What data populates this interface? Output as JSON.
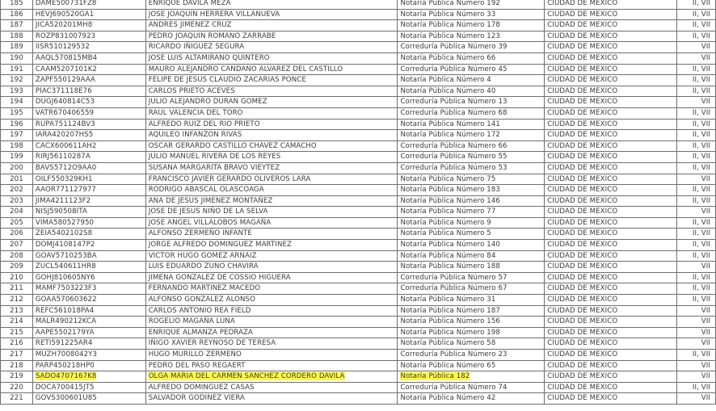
{
  "rows": [
    {
      "n": "185",
      "rfc": "DAME500731FZ8",
      "name": "ENRIQUE DAVILA MEZA",
      "office": "Notaría Pública Número 192",
      "city": "CIUDAD DE MEXICO",
      "grp": "II, VII",
      "hl": false
    },
    {
      "n": "186",
      "rfc": "HEVJ690520GA1",
      "name": "JOSE JOAQUIN HERRERA VILLANUEVA",
      "office": "Notaría Pública Número 33",
      "city": "CIUDAD DE MEXICO",
      "grp": "II, VII",
      "hl": false
    },
    {
      "n": "187",
      "rfc": "JICA520201MH8",
      "name": "ANDRES JIMENEZ CRUZ",
      "office": "Notaría Pública Número 178",
      "city": "CIUDAD DE MEXICO",
      "grp": "II, VII",
      "hl": false
    },
    {
      "n": "188",
      "rfc": "ROZP831007923",
      "name": "PEDRO JOAQUIN ROMANO ZARRABE",
      "office": "Notaría Pública Número 123",
      "city": "CIUDAD DE MEXICO",
      "grp": "II, VII",
      "hl": false
    },
    {
      "n": "189",
      "rfc": "IISR510129532",
      "name": "RICARDO IÑIGUEZ SEGURA",
      "office": "Correduría Pública Número 39",
      "city": "CIUDAD DE MEXICO",
      "grp": "VII",
      "hl": false
    },
    {
      "n": "190",
      "rfc": "AAQL570815MB4",
      "name": "JOSE LUIS ALTAMIRANO QUINTERO",
      "office": "Notaría Pública Número 66",
      "city": "CIUDAD DE MEXICO",
      "grp": "VII",
      "hl": false
    },
    {
      "n": "191",
      "rfc": "CAAM5207101K2",
      "name": "MAURO ALEJANDRO CANDANO ALVAREZ DEL CASTILLO",
      "office": "Correduría Pública Número 45",
      "city": "CIUDAD DE MEXICO",
      "grp": "II, VII",
      "hl": false
    },
    {
      "n": "192",
      "rfc": "ZAPF550129AAA",
      "name": "FELIPE DE JESUS CLAUDIO ZACARIAS PONCE",
      "office": "Notaría Pública Número 4",
      "city": "CIUDAD DE MEXICO",
      "grp": "II, VII",
      "hl": false
    },
    {
      "n": "193",
      "rfc": "PIAC371118E76",
      "name": "CARLOS PRIETO ACEVES",
      "office": "Notaría Pública Número 40",
      "city": "CIUDAD DE MEXICO",
      "grp": "II, VII",
      "hl": false
    },
    {
      "n": "194",
      "rfc": "DUGJ640814C53",
      "name": "JULIO ALEJANDRO DURAN GOMEZ",
      "office": "Correduría Pública Número 13",
      "city": "CIUDAD DE MEXICO",
      "grp": "VII",
      "hl": false
    },
    {
      "n": "195",
      "rfc": "VATR670406559",
      "name": "RAUL VALENCIA DEL TORO",
      "office": "Correduría Pública Número 68",
      "city": "CIUDAD DE MEXICO",
      "grp": "II, VII",
      "hl": false
    },
    {
      "n": "196",
      "rfc": "RUPA751124BV3",
      "name": "ALFREDO RUIZ DEL RIO PRIETO",
      "office": "Notaría Pública Número 141",
      "city": "CIUDAD DE MEXICO",
      "grp": "II, VII",
      "hl": false
    },
    {
      "n": "197",
      "rfc": "IARA420207HS5",
      "name": "AQUILEO INFANZON RIVAS",
      "office": "Notaría Pública Número 172",
      "city": "CIUDAD DE MEXICO",
      "grp": "II, VII",
      "hl": false
    },
    {
      "n": "198",
      "rfc": "CACX600611AH2",
      "name": "OSCAR GERARDO CASTILLO CHAVEZ CAMACHO",
      "office": "Correduría Pública Número 66",
      "city": "CIUDAD DE MEXICO",
      "grp": "II, VII",
      "hl": false
    },
    {
      "n": "199",
      "rfc": "RIRJ56110287A",
      "name": "JULIO MANUEL RIVERA DE LOS REYES",
      "office": "Correduría Pública Número 55",
      "city": "CIUDAD DE MEXICO",
      "grp": "II, VII",
      "hl": false
    },
    {
      "n": "200",
      "rfc": "BAVS5712O9AA0",
      "name": "SUSANA MARGARITA BRAVO VIEYTEZ",
      "office": "Correduría Pública Número 53",
      "city": "CIUDAD DE MEXICO",
      "grp": "II, VII",
      "hl": false
    },
    {
      "n": "201",
      "rfc": "OILF550329KH1",
      "name": "FRANCISCO JAVIER GERARDO OLIVEROS LARA",
      "office": "Notaría Pública Número 75",
      "city": "CIUDAD DE MEXICO",
      "grp": "VII",
      "hl": false
    },
    {
      "n": "202",
      "rfc": "AAOR771127977",
      "name": "RODRIGO ABASCAL OLASCOAGA",
      "office": "Notaría Pública Número 183",
      "city": "CIUDAD DE MEXICO",
      "grp": "II, VII",
      "hl": false
    },
    {
      "n": "203",
      "rfc": "JIMA4211123F2",
      "name": "ANA DE JESUS JIMENEZ MONTAÑEZ",
      "office": "Notaría Pública Número 146",
      "city": "CIUDAD DE MEXICO",
      "grp": "II, VII",
      "hl": false
    },
    {
      "n": "204",
      "rfc": "NISJ590508ITA",
      "name": "JOSE DE JESUS NIÑO DE LA SELVA",
      "office": "Notaría Pública Número 77",
      "city": "CIUDAD DE MEXICO",
      "grp": "VII",
      "hl": false
    },
    {
      "n": "205",
      "rfc": "VIMA580527950",
      "name": "JOSE ANGEL VILLALOBOS MAGAÑA",
      "office": "Notaría Pública Número 9",
      "city": "CIUDAD DE MEXICO",
      "grp": "II, VII",
      "hl": false
    },
    {
      "n": "206",
      "rfc": "ZEIA5402102S8",
      "name": "ALFONSO ZERMEÑO INFANTE",
      "office": "Notaría Pública Número 5",
      "city": "CIUDAD DE MEXICO",
      "grp": "II, VII",
      "hl": false
    },
    {
      "n": "207",
      "rfc": "DOMJ4108147P2",
      "name": "JORGE ALFREDO DOMINGUEZ MARTINEZ",
      "office": "Notaría Pública Número 140",
      "city": "CIUDAD DE MEXICO",
      "grp": "II, VII",
      "hl": false
    },
    {
      "n": "208",
      "rfc": "GOAV5710253BA",
      "name": "VICTOR HUGO GOMEZ ARNAIZ",
      "office": "Notaría Pública Número 84",
      "city": "CIUDAD DE MEXICO",
      "grp": "II, VII",
      "hl": false
    },
    {
      "n": "209",
      "rfc": "ZUCL540611HR8",
      "name": "LUIS EDUARDO ZUNO CHAVIRA",
      "office": "Notaría Pública Número 188",
      "city": "CIUDAD DE MEXICO",
      "grp": "VII",
      "hl": false
    },
    {
      "n": "210",
      "rfc": "GOHJ810605NY6",
      "name": "JIMENA GONZALEZ DE COSSIO HIGUERA",
      "office": "Correduría Pública Número 57",
      "city": "CIUDAD DE MEXICO",
      "grp": "II, VII",
      "hl": false
    },
    {
      "n": "211",
      "rfc": "MAMF7503223F3",
      "name": "FERNANDO MARTINEZ MACEDO",
      "office": "Correduría Pública Número 67",
      "city": "CIUDAD DE MEXICO",
      "grp": "II, VII",
      "hl": false
    },
    {
      "n": "212",
      "rfc": "GOAA570603622",
      "name": "ALFONSO GONZALEZ ALONSO",
      "office": "Notaría Pública Número 31",
      "city": "CIUDAD DE MEXICO",
      "grp": "II, VII",
      "hl": false
    },
    {
      "n": "213",
      "rfc": "REFC561018PA4",
      "name": "CARLOS ANTONIO REA FIELD",
      "office": "Notaría Pública Número 187",
      "city": "CIUDAD DE MEXICO",
      "grp": "VII",
      "hl": false
    },
    {
      "n": "214",
      "rfc": "MALR490212KCA",
      "name": "ROGELIO MAGAÑA LUNA",
      "office": "Notaría Pública Número 156",
      "city": "CIUDAD DE MEXICO",
      "grp": "VII",
      "hl": false
    },
    {
      "n": "215",
      "rfc": "AAPE5502179YA",
      "name": "ENRIQUE ALMANZA PEDRAZA",
      "office": "Notaría Pública Número 198",
      "city": "CIUDAD DE MEXICO",
      "grp": "VII",
      "hl": false
    },
    {
      "n": "216",
      "rfc": "RETI591225AR4",
      "name": "IÑIGO XAVIER REYNOSO DE TERESA",
      "office": "Notaría Pública Número 58",
      "city": "CIUDAD DE MEXICO",
      "grp": "VII",
      "hl": false
    },
    {
      "n": "217",
      "rfc": "MUZH7008042Y3",
      "name": "HUGO MURILLO ZERMEÑO",
      "office": "Correduría Pública Número 23",
      "city": "CIUDAD DE MEXICO",
      "grp": "II, VII",
      "hl": false
    },
    {
      "n": "218",
      "rfc": "PARP450218HP0",
      "name": "PEDRO DEL PASO REGAERT",
      "office": "Notaría Pública Número 65",
      "city": "CIUDAD DE MEXICO",
      "grp": "VII",
      "hl": false
    },
    {
      "n": "219",
      "rfc": "SADO4707167K8",
      "name": "OLGA MARIA DEL CARMEN SANCHEZ CORDERO DAVILA",
      "office": "Notaría Pública 182",
      "city": "CIUDAD DE MEXICO",
      "grp": "VII",
      "hl": true
    },
    {
      "n": "220",
      "rfc": "DOCA700415JT5",
      "name": "ALFREDO DOMINGUEZ CASAS",
      "office": "Correduría Pública Número 74",
      "city": "CIUDAD DE MEXICO",
      "grp": "II, VII",
      "hl": false
    },
    {
      "n": "221",
      "rfc": "GOVS300601U85",
      "name": "SALVADOR GODINEZ VIERA",
      "office": "Notaría Pública Número 42",
      "city": "CIUDAD DE MEXICO",
      "grp": "VII",
      "hl": false
    }
  ]
}
